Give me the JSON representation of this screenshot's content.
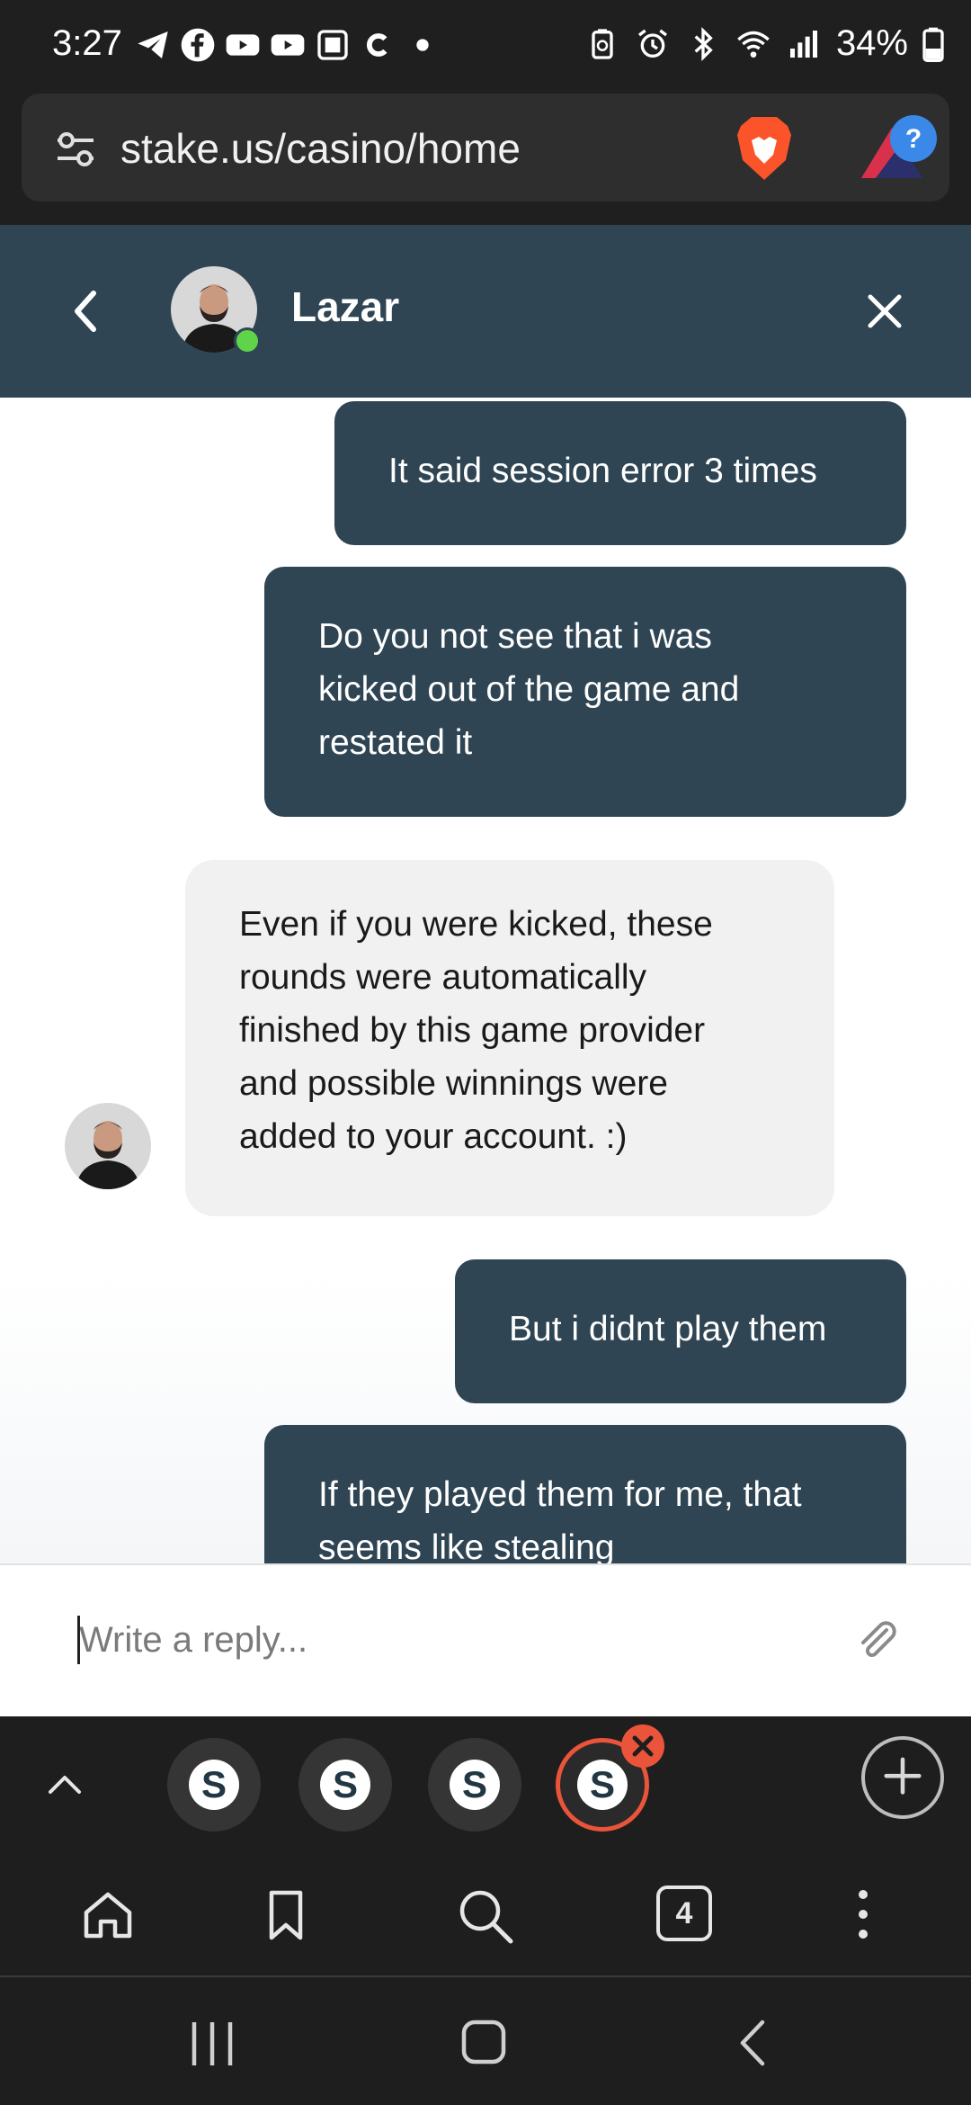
{
  "status_bar": {
    "time": "3:27",
    "battery_percent": "34%",
    "icons": [
      "telegram-icon",
      "facebook-icon",
      "youtube-icon",
      "youtube-icon",
      "cast-icon",
      "c-icon",
      "dot-icon",
      "recycle-icon",
      "alarm-icon",
      "bluetooth-icon",
      "wifi-icon",
      "signal-icon",
      "battery-icon"
    ]
  },
  "browser": {
    "url": "stake.us/casino/home",
    "extension_badge": "?"
  },
  "chat": {
    "agent_name": "Lazar",
    "agent_online": true,
    "messages": [
      {
        "from": "user",
        "lines": [
          "It said session error 3 times"
        ]
      },
      {
        "from": "user",
        "lines": [
          "Do you not see that i was",
          "kicked out of the game and",
          "restated it"
        ]
      },
      {
        "from": "agent",
        "lines": [
          "Even if you were kicked, these",
          "rounds were automatically",
          "finished by this game provider",
          "and possible winnings were",
          "added to your account. :)"
        ]
      },
      {
        "from": "user",
        "lines": [
          "But i didnt play them"
        ]
      },
      {
        "from": "user",
        "lines": [
          "If they played them for me, that",
          "seems like stealing"
        ]
      }
    ],
    "reply_placeholder": "Write a reply..."
  },
  "tabs": {
    "count": "4",
    "tab_letter": "S",
    "active_index": 3
  },
  "colors": {
    "header_bg": "#2f4553",
    "outgoing_bubble": "#2f4553",
    "incoming_bubble": "#f1f1f1",
    "active_tab_ring": "#e9543a",
    "online_dot": "#5fd34a"
  }
}
